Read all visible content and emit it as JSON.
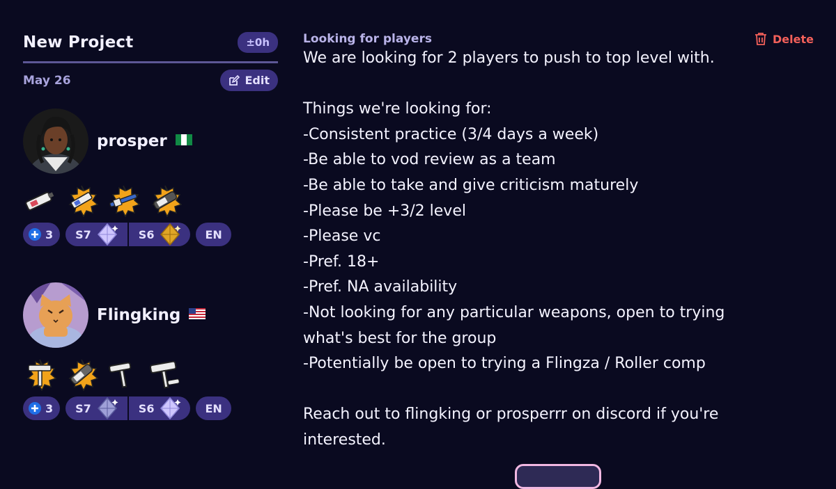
{
  "post": {
    "title": "New Project",
    "time_badge": "±0h",
    "date": "May 26",
    "edit_label": "Edit",
    "type_label": "Looking for players",
    "delete_label": "Delete",
    "description_lines": [
      "We are looking for 2 players to push to top level with.",
      "",
      "Things we're looking for:",
      "-Consistent practice (3/4 days a week)",
      "-Be able to vod review as a team",
      "-Be able to take and give criticism maturely",
      "-Please be +3/2 level",
      "-Please vc",
      "-Pref. 18+",
      "-Pref. NA availability",
      "-Not looking for any particular weapons, open to trying",
      "what's best for the group",
      "-Potentially be open to trying a Flingza / Roller comp",
      "",
      "Reach out to flingking or prosperrr on discord if you're",
      "interested."
    ]
  },
  "players": [
    {
      "name": "prosper",
      "flag": "flag-nigeria-icon",
      "weapons": [
        "splattershot-jr-icon",
        "weapon-splatted-icon",
        "charger-icon",
        "splatling-icon"
      ],
      "plus_tier": "3",
      "seasons": [
        {
          "label": "S7",
          "rank": "diamond-rank-icon"
        },
        {
          "label": "S6",
          "rank": "gold-rank-icon"
        }
      ],
      "language": "EN"
    },
    {
      "name": "Flingking",
      "flag": "flag-usa-icon",
      "weapons": [
        "flingza-roller-icon",
        "splatling-icon",
        "carbon-roller-icon",
        "roller-icon"
      ],
      "plus_tier": "3",
      "seasons": [
        {
          "label": "S7",
          "rank": "diamond-rank-icon"
        },
        {
          "label": "S6",
          "rank": "diamond-rank-icon"
        }
      ],
      "language": "EN"
    }
  ],
  "colors": {
    "background": "#0a0a20",
    "badge": "#3b3180",
    "accent_text": "#a8a3dc",
    "delete": "#f3605a"
  }
}
